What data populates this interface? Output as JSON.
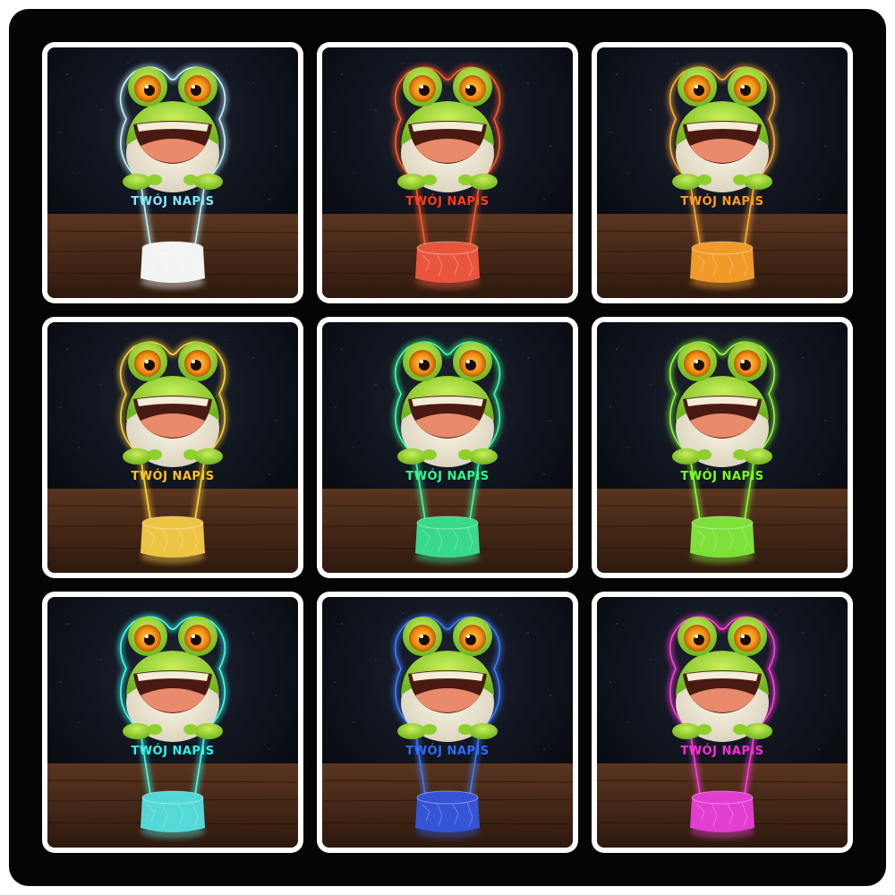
{
  "grid": {
    "tiles": [
      {
        "caption": "TWÓJ NAPIS",
        "glow": "#bff5ff",
        "text_color": "#7fe8ff",
        "base": "#f2f4f4"
      },
      {
        "caption": "TWÓJ NAPIS",
        "glow": "#ff5a2a",
        "text_color": "#ff3c1c",
        "base": "#e9553c"
      },
      {
        "caption": "TWÓJ NAPIS",
        "glow": "#ffab3a",
        "text_color": "#ff9a1e",
        "base": "#f09a2a"
      },
      {
        "caption": "TWÓJ NAPIS",
        "glow": "#ffd438",
        "text_color": "#ffc21e",
        "base": "#eec445"
      },
      {
        "caption": "TWÓJ NAPIS",
        "glow": "#3dffa0",
        "text_color": "#2dff8e",
        "base": "#39d98a"
      },
      {
        "caption": "TWÓJ NAPIS",
        "glow": "#8aff3c",
        "text_color": "#7aff1e",
        "base": "#7ee13a"
      },
      {
        "caption": "TWÓJ NAPIS",
        "glow": "#3dfff0",
        "text_color": "#2ef6ea",
        "base": "#55d9d8"
      },
      {
        "caption": "TWÓJ NAPIS",
        "glow": "#3d7cff",
        "text_color": "#2f6bff",
        "base": "#3554d6"
      },
      {
        "caption": "TWÓJ NAPIS",
        "glow": "#ff3de0",
        "text_color": "#ff2ed6",
        "base": "#e23ed1"
      }
    ]
  }
}
